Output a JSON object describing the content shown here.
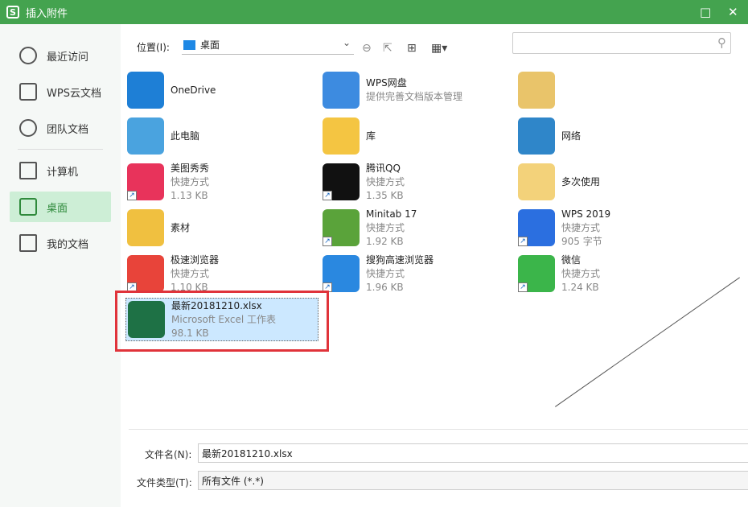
{
  "window": {
    "title": "插入附件",
    "logo": "S",
    "maximize_icon": "□",
    "close_icon": "✕"
  },
  "sidebar": {
    "items": [
      {
        "label": "最近访问",
        "icon": "clock-icon"
      },
      {
        "label": "WPS云文档",
        "icon": "cube-icon"
      },
      {
        "label": "团队文档",
        "icon": "team-icon"
      },
      {
        "label": "计算机",
        "icon": "monitor-icon"
      },
      {
        "label": "桌面",
        "icon": "desktop-icon",
        "active": true
      },
      {
        "label": "我的文档",
        "icon": "documents-icon"
      }
    ]
  },
  "toolbar": {
    "location_label": "位置(I):",
    "location_value": "桌面",
    "search_placeholder": ""
  },
  "files": [
    {
      "name": "OneDrive",
      "sub": "",
      "size": "",
      "color": "#1e7fd6"
    },
    {
      "name": "WPS网盘",
      "sub": "提供完善文档版本管理",
      "size": "",
      "color": "#3d8be0"
    },
    {
      "name": "",
      "sub": "",
      "size": "",
      "color": "#e9c46a"
    },
    {
      "name": "此电脑",
      "sub": "",
      "size": "",
      "color": "#4aa3df"
    },
    {
      "name": "库",
      "sub": "",
      "size": "",
      "color": "#f4c542"
    },
    {
      "name": "网络",
      "sub": "",
      "size": "",
      "color": "#2f86c9"
    },
    {
      "name": "美图秀秀",
      "sub": "快捷方式",
      "size": "1.13 KB",
      "color": "#e8335b"
    },
    {
      "name": "腾讯QQ",
      "sub": "快捷方式",
      "size": "1.35 KB",
      "color": "#111111"
    },
    {
      "name": "多次使用",
      "sub": "",
      "size": "",
      "color": "#f3d27a"
    },
    {
      "name": "素材",
      "sub": "",
      "size": "",
      "color": "#f0c040"
    },
    {
      "name": "Minitab 17",
      "sub": "快捷方式",
      "size": "1.92 KB",
      "color": "#5aa33a"
    },
    {
      "name": "WPS 2019",
      "sub": "快捷方式",
      "size": "905 字节",
      "color": "#2b6fe0"
    },
    {
      "name": "极速浏览器",
      "sub": "快捷方式",
      "size": "1.10 KB",
      "color": "#e8443a"
    },
    {
      "name": "搜狗高速浏览器",
      "sub": "快捷方式",
      "size": "1.96 KB",
      "color": "#2a88e0"
    },
    {
      "name": "微信",
      "sub": "快捷方式",
      "size": "1.24 KB",
      "color": "#3bb54a"
    },
    {
      "name": "最新20181210.xlsx",
      "sub": "Microsoft Excel 工作表",
      "size": "98.1 KB",
      "color": "#1e7145",
      "selected": true
    }
  ],
  "form": {
    "filename_label": "文件名(N):",
    "filename_value": "最新20181210.xlsx",
    "filetype_label": "文件类型(T):",
    "filetype_value": "所有文件 (*.*)"
  }
}
